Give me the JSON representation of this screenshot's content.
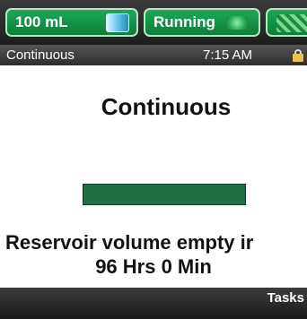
{
  "header": {
    "volume_label": "100 mL",
    "volume_icon": "reservoir-vial-icon",
    "status_label": "Running",
    "status_icon": "running-indicator-icon",
    "signal_icon": "connection-signal-icon",
    "accent_color": "#1ca858"
  },
  "status_bar": {
    "mode": "Continuous",
    "time": "7:15 AM",
    "lock_icon": "lock-icon"
  },
  "main": {
    "title": "Continuous",
    "progress_fraction": 1.0,
    "message_line1": "Reservoir volume empty ir",
    "message_line2": "96 Hrs 0 Min"
  },
  "footer": {
    "tasks_label": "Tasks"
  }
}
